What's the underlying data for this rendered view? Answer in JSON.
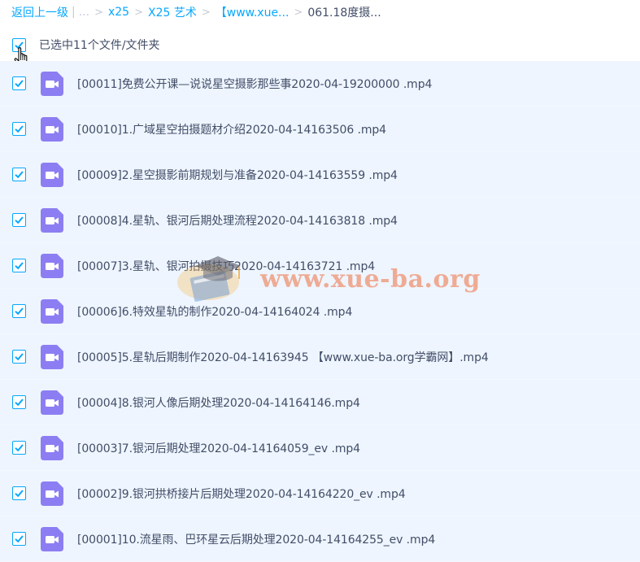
{
  "breadcrumb": {
    "back": "返回上一级",
    "bar": "|",
    "ellipsis": "...",
    "sep": ">",
    "items": [
      "x25",
      "X25 艺术",
      "【www.xue..."
    ],
    "current": "061.18度摄..."
  },
  "selection": {
    "label": "已选中11个文件/文件夹"
  },
  "files": [
    {
      "name": "[00011]免费公开课—说说星空摄影那些事2020-04-19200000 .mp4"
    },
    {
      "name": "[00010]1.广域星空拍摄题材介绍2020-04-14163506 .mp4"
    },
    {
      "name": "[00009]2.星空摄影前期规划与准备2020-04-14163559 .mp4"
    },
    {
      "name": "[00008]4.星轨、银河后期处理流程2020-04-14163818 .mp4"
    },
    {
      "name": "[00007]3.星轨、银河拍摄技巧2020-04-14163721 .mp4"
    },
    {
      "name": "[00006]6.特效星轨的制作2020-04-14164024 .mp4"
    },
    {
      "name": "[00005]5.星轨后期制作2020-04-14163945 【www.xue-ba.org学霸网】.mp4"
    },
    {
      "name": "[00004]8.银河人像后期处理2020-04-14164146.mp4"
    },
    {
      "name": "[00003]7.银河后期处理2020-04-14164059_ev .mp4"
    },
    {
      "name": "[00002]9.银河拱桥接片后期处理2020-04-14164220_ev .mp4"
    },
    {
      "name": "[00001]10.流星雨、巴环星云后期处理2020-04-14164255_ev .mp4"
    }
  ],
  "watermark": {
    "text": "www.xue-ba.org"
  },
  "colors": {
    "accent": "#06a7ff",
    "row_bg": "#eef5ff",
    "video_icon": "#8c7ef2",
    "text": "#424e67"
  },
  "icons": {
    "checkbox": "checkmark-icon",
    "file": "video-file-icon",
    "cursor": "hand-cursor-icon"
  }
}
